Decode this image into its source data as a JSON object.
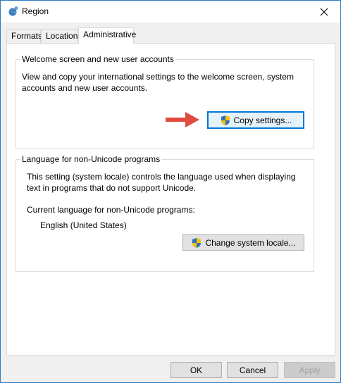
{
  "window": {
    "title": "Region",
    "title_icon": "region-globe-icon",
    "close_icon": "close-icon"
  },
  "tabs": [
    {
      "label": "Formats",
      "active": false
    },
    {
      "label": "Location",
      "active": false
    },
    {
      "label": "Administrative",
      "active": true
    }
  ],
  "welcome_group": {
    "title": "Welcome screen and new user accounts",
    "description_line1": "View and copy your international settings to the welcome screen, system",
    "description_line2": "accounts and new user accounts.",
    "copy_button_label": "Copy settings..."
  },
  "unicode_group": {
    "title": "Language for non-Unicode programs",
    "description_line1": "This setting (system locale) controls the language used when displaying",
    "description_line2": "text in programs that do not support Unicode.",
    "current_label": "Current language for non-Unicode programs:",
    "current_value": "English (United States)",
    "change_button_label": "Change system locale..."
  },
  "footer": {
    "ok_label": "OK",
    "cancel_label": "Cancel",
    "apply_label": "Apply"
  },
  "colors": {
    "arrow": "#e04a3f",
    "focus": "#0078d7",
    "shield_blue": "#2f6fc2",
    "shield_yellow": "#f5c400"
  }
}
